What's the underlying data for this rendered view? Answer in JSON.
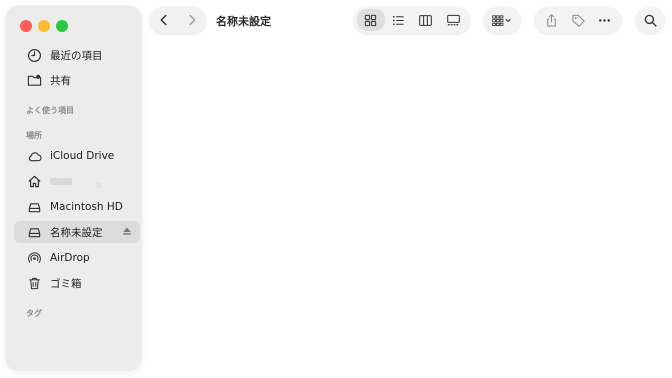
{
  "window": {
    "title": "名称未設定"
  },
  "sidebar": {
    "items_top": [
      {
        "label": "最近の項目",
        "icon": "clock-icon"
      },
      {
        "label": "共有",
        "icon": "shared-folder-icon"
      }
    ],
    "favorites_label": "よく使う項目",
    "locations_label": "場所",
    "locations": [
      {
        "label": "iCloud Drive",
        "icon": "cloud-icon"
      },
      {
        "label": "",
        "icon": "home-icon"
      },
      {
        "label": "Macintosh HD",
        "icon": "hard-drive-icon"
      },
      {
        "label": "名称未設定",
        "icon": "external-drive-icon",
        "selected": true
      },
      {
        "label": "AirDrop",
        "icon": "airdrop-icon"
      },
      {
        "label": "ゴミ箱",
        "icon": "trash-icon"
      }
    ],
    "tags_label": "タグ"
  },
  "toolbar": {
    "views": [
      "icon-view",
      "list-view",
      "column-view",
      "gallery-view"
    ],
    "active_view": "icon-view",
    "group": "group-icon",
    "actions": [
      "share-icon",
      "tag-icon",
      "more-icon"
    ],
    "search": "search-icon"
  },
  "colors": {
    "close": "#ff5f57",
    "minimize": "#febc2e",
    "zoom": "#28c840",
    "sidebar_bg": "#ececec",
    "selected_bg": "#dcdcdc"
  }
}
